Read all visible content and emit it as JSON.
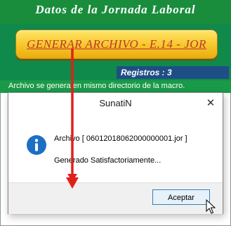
{
  "app": {
    "title": "Datos de la Jornada Laboral",
    "generate_button_label": "GENERAR ARCHIVO - E.14 - JOR",
    "registros_label": "Registros : 3",
    "status_text": "Archivo se genera en mismo directorio de la macro."
  },
  "dialog": {
    "title": "SunatiN",
    "close_glyph": "✕",
    "message_line1": "Archivo [ 06012018062000000001.jor ]",
    "message_line2": "Generado Satisfactoriamente...",
    "ok_label": "Aceptar",
    "icon": "info-icon"
  },
  "colors": {
    "header_green": "#1a8d3c",
    "button_gold": "#f6c629",
    "button_text_red": "#c1352d",
    "registros_blue": "#1f4e86",
    "arrow_red": "#e0201b"
  }
}
